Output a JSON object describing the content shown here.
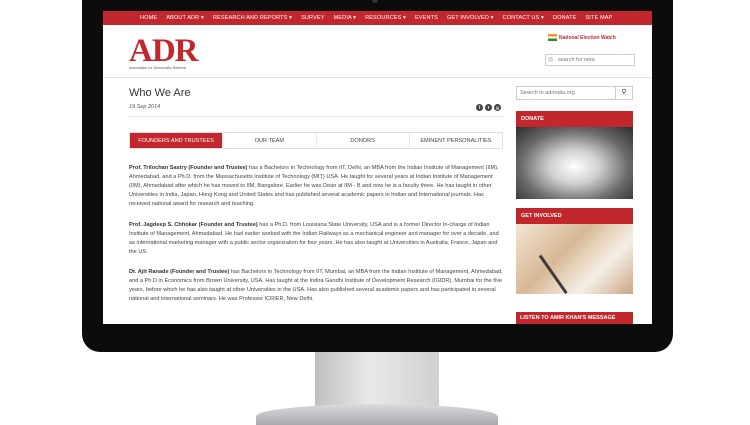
{
  "nav": [
    "HOME",
    "ABOUT ADR ▾",
    "RESEARCH AND REPORTS ▾",
    "SURVEY",
    "MEDIA ▾",
    "RESOURCES ▾",
    "EVENTS",
    "GET INVOLVED ▾",
    "CONTACT US ▾",
    "DONATE",
    "SITE MAP"
  ],
  "header": {
    "logo_text": "ADR",
    "logo_sub": "Association for Democratic Reforms",
    "new_logo": "National Election Watch",
    "search_placeholder": "search for neta"
  },
  "page": {
    "title": "Who We Are",
    "date": "19 Sep 2014",
    "social": [
      "f",
      "t",
      "g"
    ]
  },
  "tabs": [
    "FOUNDERS AND TRUSTEES",
    "OUR TEAM",
    "DONORS",
    "EMINENT PERSONALITIES"
  ],
  "bios": [
    {
      "name": "Prof. Trilochan Sastry (Founder and Trustee)",
      "text": " has a Bachelors in Technology from IIT, Delhi, an MBA from the Indian Institute of Management (IIM), Ahmedabad, and a Ph.D. from the Massachusetts Institute of Technology (MIT) USA. He taught for several years at Indian Institute of Management (IIM), Ahmedabad after which he has moved to IIM, Bangalore. Earlier he was Dean at IIM - B and now he is a faculty there. He has taught in other Universities in India, Japan, Hong Kong and United States and has published several academic papers in Indian and International journals. Has received national award for research and teaching."
    },
    {
      "name": "Prof. Jagdeep S. Chhokar (Founder and Trustee)",
      "text": " has a Ph.D. from Louisiana State University, USA and is a former Director In-charge of Indian Institute of Management, Ahmedabad. He had earlier worked with the Indian Railways as a mechanical engineer and manager for over a decade, and as international marketing manager with a public sector organization for four years. He has also taught at Universities in Australia, France, Japan and the US."
    },
    {
      "name": "Dr. Ajit Ranade (Founder and Trustee)",
      "text": " has Bachelors in Technology from IIT, Mumbai, an MBA from the Indian Institute of Management, Ahmedabad, and a Ph.D in Economics from Brown University, USA. Has taught at the Indira Gandhi Institute of Development Research (IGIDR), Mumbai for the five years, before which he has also taught at other Universities in the USA. Has also published several academic papers and has participated in several national and international seminars. He was Professor ICRIER, New Delhi."
    }
  ],
  "sidebar": {
    "search_placeholder": "Search in adrindia.org",
    "search_icon": "magnifier-icon",
    "donate_label": "DONATE",
    "get_involved_label": "GET INVOLVED",
    "listen_label": "LISTEN TO AMIR KHAN'S MESSAGE"
  },
  "colors": {
    "brand_red": "#c2272d"
  }
}
